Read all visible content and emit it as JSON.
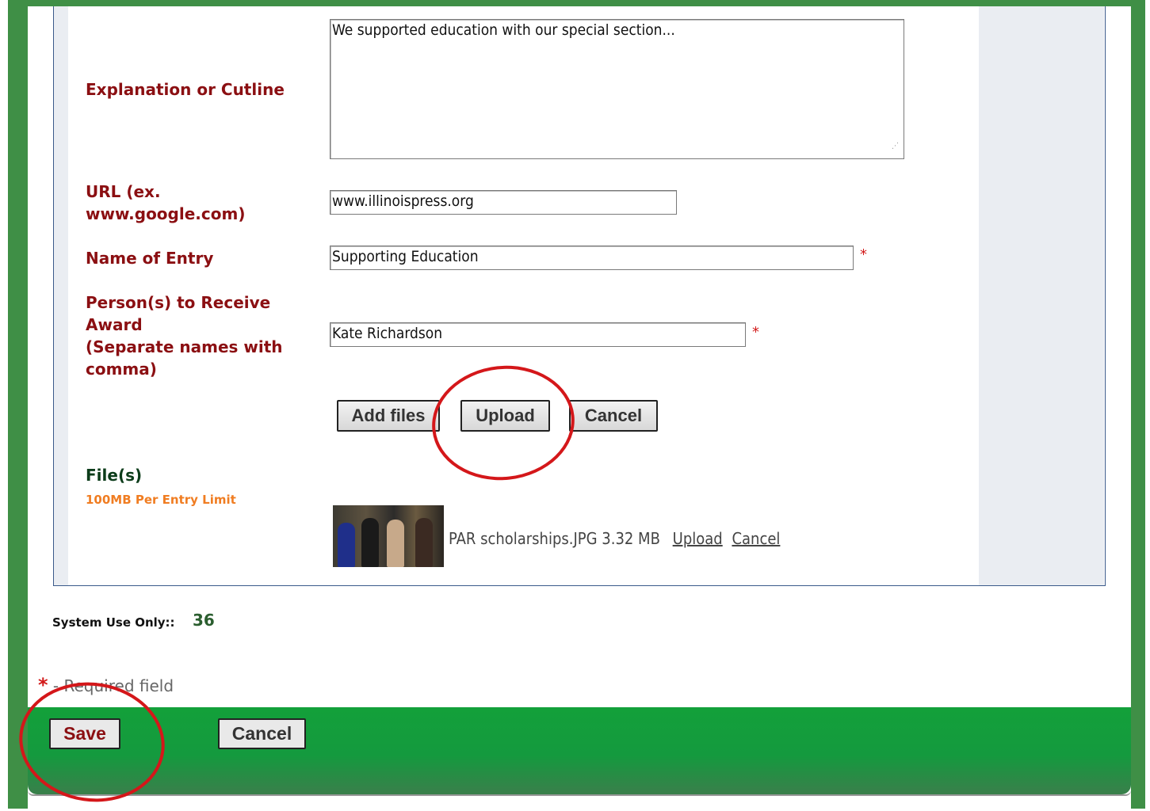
{
  "form": {
    "explanation": {
      "label": "Explanation or Cutline",
      "value": "We supported education with our special section..."
    },
    "url": {
      "label_line1": "URL (ex.",
      "label_line2": "www.google.com)",
      "value": "www.illinoispress.org"
    },
    "entry_name": {
      "label": "Name of Entry",
      "value": "Supporting Education",
      "required_mark": "*"
    },
    "recipients": {
      "label_line1": "Person(s) to Receive",
      "label_line2": "Award",
      "label_line3": "(Separate names with",
      "label_line4": "comma)",
      "value": "Kate Richardson",
      "required_mark": "*"
    },
    "upload_buttons": {
      "add_files": "Add files",
      "upload": "Upload",
      "cancel": "Cancel"
    },
    "files": {
      "label": "File(s)",
      "limit": "100MB Per Entry Limit",
      "items": [
        {
          "name": "PAR scholarships.JPG",
          "size": "3.32 MB",
          "upload_link": "Upload",
          "cancel_link": "Cancel"
        }
      ]
    }
  },
  "system": {
    "label": "System Use Only::",
    "value": "36"
  },
  "required_note": {
    "star": "*",
    "text": "- Required field"
  },
  "footer": {
    "save": "Save",
    "cancel": "Cancel"
  },
  "colors": {
    "label": "#8b0f12",
    "frame_green": "#3f8f46",
    "footer_green": "#13a03a",
    "annotation_red": "#d4171a",
    "limit_orange": "#f07d22"
  }
}
